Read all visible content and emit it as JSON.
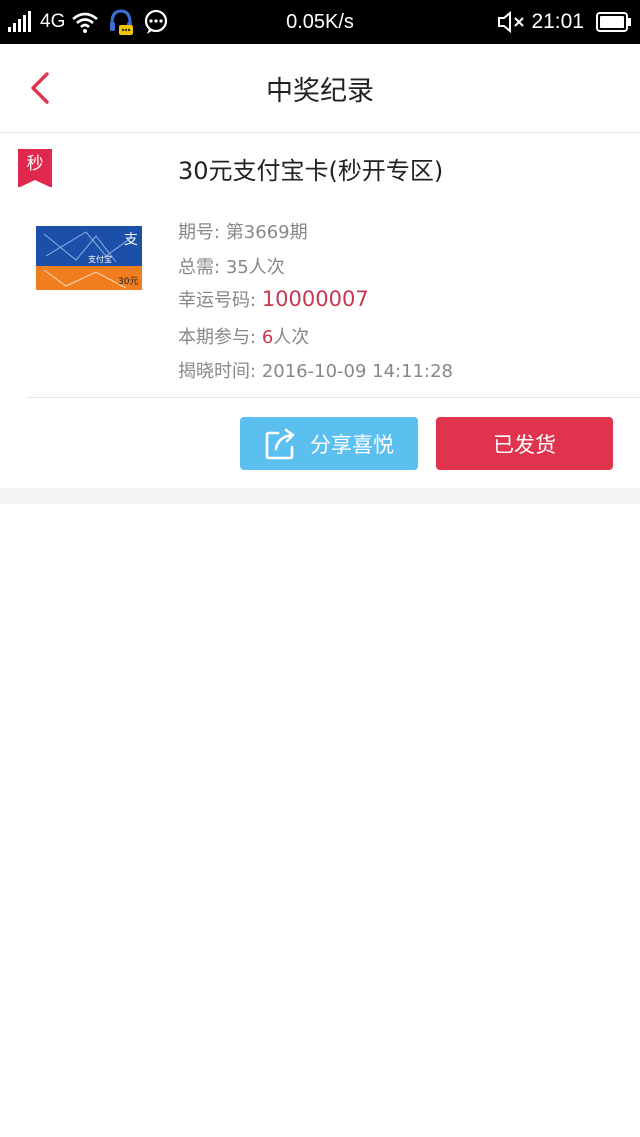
{
  "status_bar": {
    "network_type": "4G",
    "net_speed": "0.05K/s",
    "time": "21:01",
    "icons": [
      "signal-icon",
      "wifi-icon",
      "headset-notification-icon",
      "chat-notification-icon",
      "mute-icon",
      "battery-icon"
    ]
  },
  "header": {
    "title": "中奖纪录",
    "back_icon": "chevron-left-icon"
  },
  "record": {
    "tag": "秒",
    "title": "30元支付宝卡(秒开专区)",
    "image_text": {
      "brand_char": "支",
      "logo": "支付宝",
      "denomination": "30元"
    },
    "issue_label": "期号:",
    "issue_value": "第3669期",
    "need_label": "总需:",
    "need_value": "35人次",
    "lucky_label": "幸运号码:",
    "lucky_value": "10000007",
    "join_label": "本期参与:",
    "join_count": "6",
    "join_unit": "人次",
    "time_label": "揭晓时间:",
    "time_value": "2016-10-09 14:11:28"
  },
  "actions": {
    "share_label": "分享喜悦",
    "shipped_label": "已发货"
  },
  "colors": {
    "accent_red": "#e0334e",
    "share_blue": "#5bbff0",
    "muted_text": "#888888"
  }
}
